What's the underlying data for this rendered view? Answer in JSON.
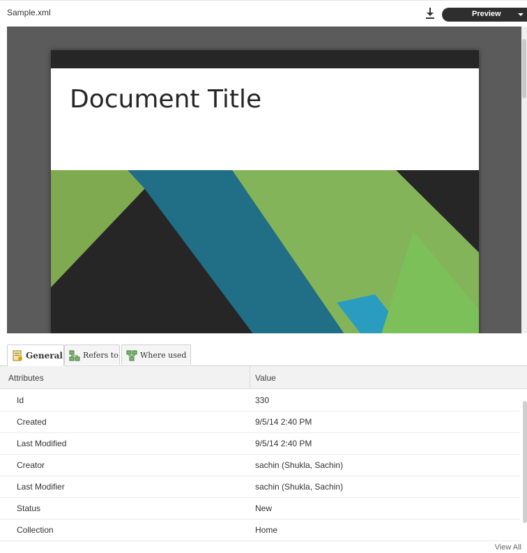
{
  "header": {
    "file_name": "Sample.xml",
    "preview_label": "Preview",
    "download_icon": "download-icon",
    "dropdown_icon": "chevron-down-icon"
  },
  "preview": {
    "document_title": "Document Title",
    "colors": {
      "background": "#5b5b5b",
      "dark": "#262626",
      "green": "#84b45a",
      "teal": "#206f86",
      "blue": "#2a9cc0"
    }
  },
  "tabs": [
    {
      "label": "General",
      "icon": "general-icon",
      "active": true
    },
    {
      "label": "Refers to",
      "icon": "refers-to-icon",
      "active": false
    },
    {
      "label": "Where used",
      "icon": "where-used-icon",
      "active": false
    }
  ],
  "table": {
    "columns": [
      "Attributes",
      "Value"
    ],
    "rows": [
      {
        "attribute": "Id",
        "value": "330"
      },
      {
        "attribute": "Created",
        "value": "9/5/14 2:40 PM"
      },
      {
        "attribute": "Last Modified",
        "value": "9/5/14 2:40 PM"
      },
      {
        "attribute": "Creator",
        "value": "sachin (Shukla, Sachin)"
      },
      {
        "attribute": "Last Modifier",
        "value": "sachin (Shukla, Sachin)"
      },
      {
        "attribute": "Status",
        "value": "New"
      },
      {
        "attribute": "Collection",
        "value": "Home"
      }
    ]
  },
  "footer": {
    "view_all_label": "View All"
  }
}
